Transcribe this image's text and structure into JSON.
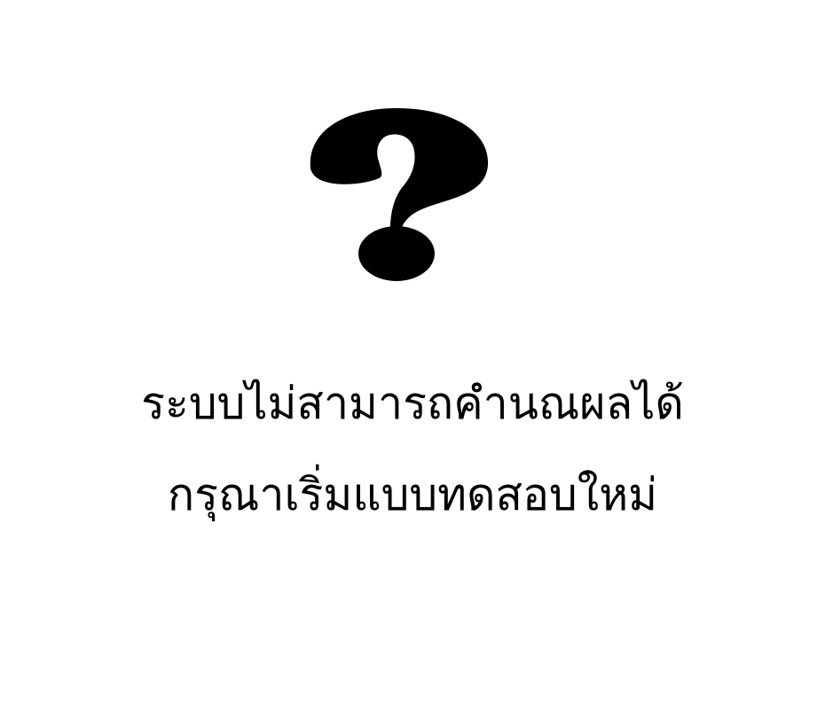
{
  "icon": {
    "name": "question-mark-icon",
    "color": "#000000"
  },
  "message": {
    "line1": "ระบบไม่สามารถคำนณผลได้",
    "line2": "กรุณาเริ่มแบบทดสอบใหม่"
  },
  "colors": {
    "background": "#ffffff",
    "text": "#000000"
  }
}
